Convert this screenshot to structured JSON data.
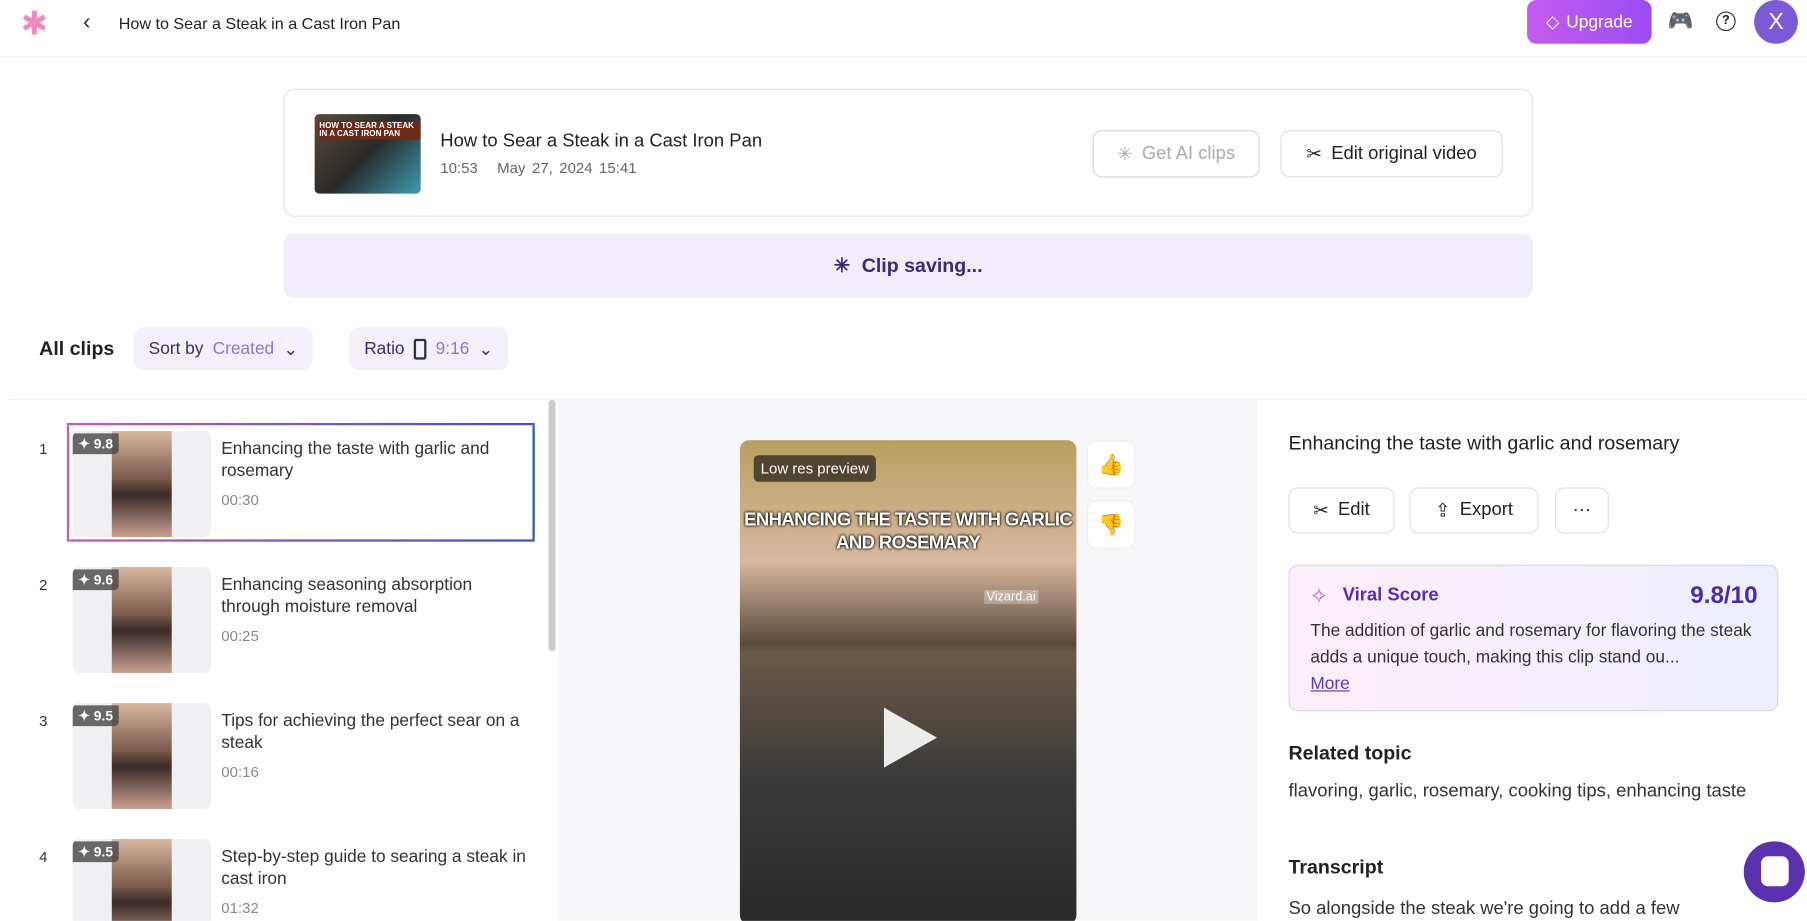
{
  "header": {
    "title": "How to Sear a Steak in a Cast Iron Pan",
    "upgrade_label": "Upgrade",
    "avatar_initial": "X"
  },
  "video_card": {
    "title": "How to Sear a Steak in a Cast Iron Pan",
    "duration": "10:53",
    "date": "May 27, 2024 15:41",
    "thumb_text": "HOW TO SEAR A STEAK IN A CAST IRON PAN",
    "get_ai_clips_label": "Get AI clips",
    "edit_original_label": "Edit original video"
  },
  "status": {
    "text": "Clip saving..."
  },
  "toolbar": {
    "all_clips": "All clips",
    "sort_label": "Sort by",
    "sort_value": "Created",
    "ratio_label": "Ratio",
    "ratio_value": "9:16"
  },
  "clips": [
    {
      "num": "1",
      "score": "9.8",
      "title": "Enhancing the taste with garlic and rosemary",
      "duration": "00:30"
    },
    {
      "num": "2",
      "score": "9.6",
      "title": "Enhancing seasoning absorption through moisture removal",
      "duration": "00:25"
    },
    {
      "num": "3",
      "score": "9.5",
      "title": "Tips for achieving the perfect sear on a steak",
      "duration": "00:16"
    },
    {
      "num": "4",
      "score": "9.5",
      "title": "Step-by-step guide to searing a steak in cast iron",
      "duration": "01:32"
    }
  ],
  "preview": {
    "badge": "Low res preview",
    "caption": "ENHANCING THE TASTE WITH GARLIC AND ROSEMARY",
    "watermark": "Vizard.ai"
  },
  "detail": {
    "title": "Enhancing the taste with garlic and rosemary",
    "edit_label": "Edit",
    "export_label": "Export",
    "more_label": "···",
    "viral_label": "Viral Score",
    "viral_score": "9.8/10",
    "viral_desc": "The addition of garlic and rosemary for flavoring the steak adds a unique touch, making this clip stand ou...",
    "viral_more": "More",
    "related_heading": "Related topic",
    "related_text": "flavoring, garlic, rosemary, cooking tips, enhancing taste",
    "transcript_heading": "Transcript",
    "transcript_text": "So alongside the steak we're going to add a few"
  },
  "colors": {
    "accent": "#7c5bd6",
    "upgrade": "#b455f0",
    "viral": "#4a2aa8"
  }
}
